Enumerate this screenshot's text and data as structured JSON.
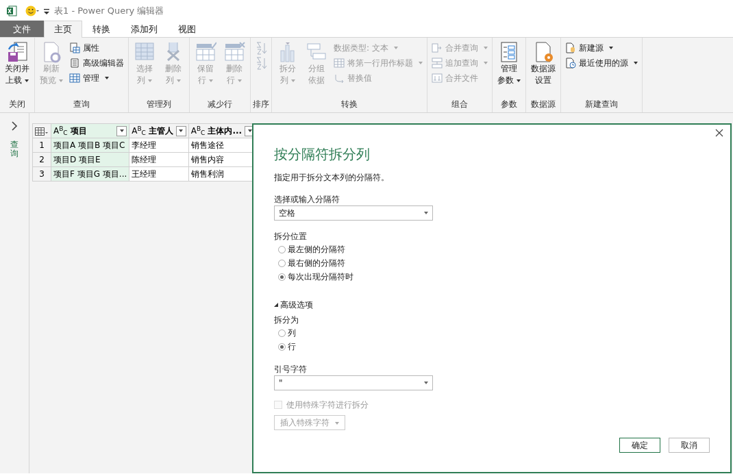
{
  "title_bar": {
    "title": "表1 - Power Query 编辑器"
  },
  "tabs": [
    {
      "label": "文件",
      "kind": "file",
      "selected": false
    },
    {
      "label": "主页",
      "kind": "tab",
      "selected": true
    },
    {
      "label": "转换",
      "kind": "tab",
      "selected": false
    },
    {
      "label": "添加列",
      "kind": "tab",
      "selected": false
    },
    {
      "label": "视图",
      "kind": "tab",
      "selected": false
    }
  ],
  "ribbon": {
    "groups": [
      {
        "label": "关闭",
        "items": [
          {
            "kind": "large",
            "lines": [
              "关闭并",
              "上载"
            ],
            "dropdown": true,
            "disabled": false
          }
        ]
      },
      {
        "label": "查询",
        "items": [
          {
            "kind": "large",
            "lines": [
              "刷新",
              "预览"
            ],
            "dropdown": true,
            "disabled": true
          },
          {
            "kind": "small",
            "label": "属性",
            "dropdown": false,
            "disabled": false
          },
          {
            "kind": "small",
            "label": "高级编辑器",
            "dropdown": false,
            "disabled": false
          },
          {
            "kind": "small",
            "label": "管理",
            "dropdown": true,
            "disabled": false
          }
        ]
      },
      {
        "label": "管理列",
        "items": [
          {
            "kind": "large",
            "lines": [
              "选择",
              "列"
            ],
            "dropdown": true,
            "disabled": true
          },
          {
            "kind": "large",
            "lines": [
              "删除",
              "列"
            ],
            "dropdown": true,
            "disabled": true
          }
        ]
      },
      {
        "label": "减少行",
        "items": [
          {
            "kind": "large",
            "lines": [
              "保留",
              "行"
            ],
            "dropdown": true,
            "disabled": true
          },
          {
            "kind": "large",
            "lines": [
              "删除",
              "行"
            ],
            "dropdown": true,
            "disabled": true
          }
        ]
      },
      {
        "label": "排序",
        "items": [
          {
            "kind": "icon",
            "disabled": true
          },
          {
            "kind": "icon",
            "disabled": true
          }
        ]
      },
      {
        "label": "转换",
        "items": [
          {
            "kind": "large",
            "lines": [
              "拆分",
              "列"
            ],
            "dropdown": true,
            "disabled": true
          },
          {
            "kind": "large",
            "lines": [
              "分组",
              "依据"
            ],
            "dropdown": false,
            "disabled": true
          },
          {
            "kind": "small",
            "label": "数据类型: 文本",
            "dropdown": true,
            "disabled": true
          },
          {
            "kind": "small",
            "label": "将第一行用作标题",
            "dropdown": true,
            "disabled": true
          },
          {
            "kind": "small",
            "label": "替换值",
            "dropdown": false,
            "disabled": true
          }
        ]
      },
      {
        "label": "组合",
        "items": [
          {
            "kind": "small",
            "label": "合并查询",
            "dropdown": true,
            "disabled": true
          },
          {
            "kind": "small",
            "label": "追加查询",
            "dropdown": true,
            "disabled": true
          },
          {
            "kind": "small",
            "label": "合并文件",
            "dropdown": false,
            "disabled": true
          }
        ]
      },
      {
        "label": "参数",
        "items": [
          {
            "kind": "large",
            "lines": [
              "管理",
              "参数"
            ],
            "dropdown": true,
            "disabled": false
          }
        ]
      },
      {
        "label": "数据源",
        "items": [
          {
            "kind": "large",
            "lines": [
              "数据源",
              "设置"
            ],
            "dropdown": false,
            "disabled": false
          }
        ]
      },
      {
        "label": "新建查询",
        "items": [
          {
            "kind": "small",
            "label": "新建源",
            "dropdown": true,
            "disabled": false
          },
          {
            "kind": "small",
            "label": "最近使用的源",
            "dropdown": true,
            "disabled": false
          }
        ]
      }
    ]
  },
  "queries_pane": {
    "label": "查询",
    "expanded": false
  },
  "table": {
    "columns": [
      {
        "type": "A$^{B}$$_{C}$",
        "label": "项目",
        "selected": true
      },
      {
        "type": "A$^{B}$$_{C}$",
        "label": "主管人",
        "selected": false
      },
      {
        "type": "A$^{B}$$_{C}$",
        "label": "主体内...",
        "selected": false
      }
    ],
    "rows": [
      {
        "number": "1",
        "cells": [
          "项目A 项目B 项目C",
          "李经理",
          "销售途径"
        ]
      },
      {
        "number": "2",
        "cells": [
          "项目D 项目E",
          "陈经理",
          "销售内容"
        ]
      },
      {
        "number": "3",
        "cells": [
          "项目F 项目G 项目...",
          "王经理",
          "销售利润"
        ]
      }
    ]
  },
  "dialog": {
    "title": "按分隔符拆分列",
    "description": "指定用于拆分文本列的分隔符。",
    "delimiter": {
      "label": "选择或输入分隔符",
      "value": "空格"
    },
    "split_position": {
      "label": "拆分位置",
      "options": [
        {
          "label": "最左侧的分隔符",
          "selected": false
        },
        {
          "label": "最右侧的分隔符",
          "selected": false
        },
        {
          "label": "每次出现分隔符时",
          "selected": true
        }
      ]
    },
    "advanced": {
      "label": "高级选项",
      "expanded": true,
      "split_into": {
        "label": "拆分为",
        "options": [
          {
            "label": "列",
            "selected": false
          },
          {
            "label": "行",
            "selected": true
          }
        ]
      },
      "quote_char": {
        "label": "引号字符",
        "value": "\""
      },
      "special_chars": {
        "label": "使用特殊字符进行拆分",
        "checked": false,
        "disabled": true
      },
      "insert_button": {
        "label": "插入特殊字符",
        "disabled": true
      }
    },
    "buttons": [
      {
        "label": "确定",
        "kind": "primary"
      },
      {
        "label": "取消",
        "kind": "secondary"
      }
    ]
  }
}
